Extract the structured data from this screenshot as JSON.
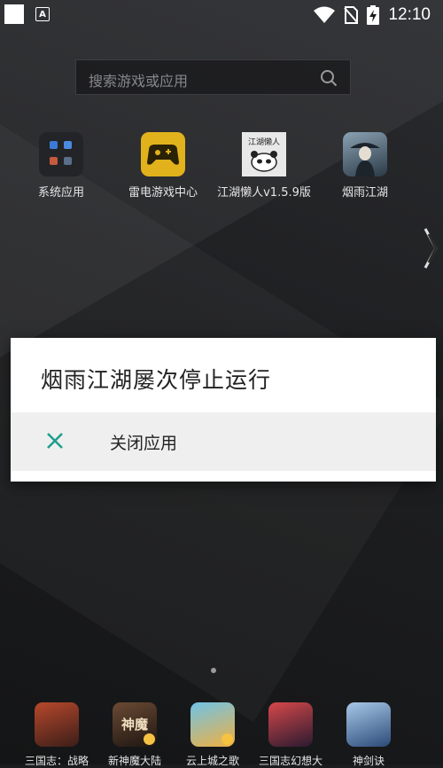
{
  "status_bar": {
    "notification_icon": "accessibility-a-icon",
    "time": "12:10"
  },
  "search": {
    "placeholder": "搜索游戏或应用"
  },
  "apps": [
    {
      "label": "系统应用",
      "icon": "system-folder-icon"
    },
    {
      "label": "雷电游戏中心",
      "icon": "gamepad-icon"
    },
    {
      "label": "江湖懒人v1.5.9版",
      "icon": "jianghu-lanren-icon",
      "icon_text": "江湖懒人"
    },
    {
      "label": "烟雨江湖",
      "icon": "yanyu-jianghu-icon"
    }
  ],
  "dialog": {
    "title": "烟雨江湖屡次停止运行",
    "action_label": "关闭应用",
    "accent_color": "#1e9e8e"
  },
  "dock": [
    {
      "label": "三国志：战略"
    },
    {
      "label": "新神魔大陆",
      "icon_text": "神魔"
    },
    {
      "label": "云上城之歌"
    },
    {
      "label": "三国志幻想大"
    },
    {
      "label": "神剑诀"
    }
  ]
}
